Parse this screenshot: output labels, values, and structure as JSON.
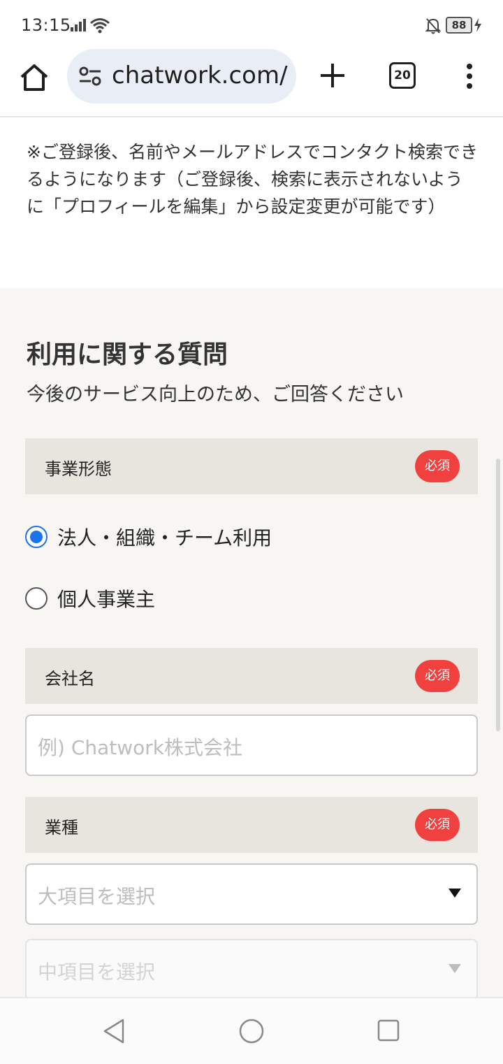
{
  "status_bar": {
    "time": "13:15",
    "battery": "88"
  },
  "browser": {
    "url": "chatwork.com/",
    "tab_count": "20"
  },
  "notice": "※ご登録後、名前やメールアドレスでコンタクト検索できるようになります（ご登録後、検索に表示されないように「プロフィールを編集」から設定変更が可能です）",
  "section": {
    "title": "利用に関する質問",
    "subtitle": "今後のサービス向上のため、ご回答ください"
  },
  "fields": {
    "business_type": {
      "label": "事業形態",
      "required": "必須",
      "options": [
        "法人・組織・チーム利用",
        "個人事業主"
      ],
      "selected": "法人・組織・チーム利用"
    },
    "company_name": {
      "label": "会社名",
      "required": "必須",
      "placeholder": "例) Chatwork株式会社"
    },
    "industry": {
      "label": "業種",
      "required": "必須",
      "major_placeholder": "大項目を選択",
      "minor_placeholder": "中項目を選択"
    }
  },
  "colors": {
    "accent": "#1a73e8",
    "required_badge": "#f1413e",
    "field_header": "#e7e5de",
    "section_bg": "#f7f6f3"
  }
}
